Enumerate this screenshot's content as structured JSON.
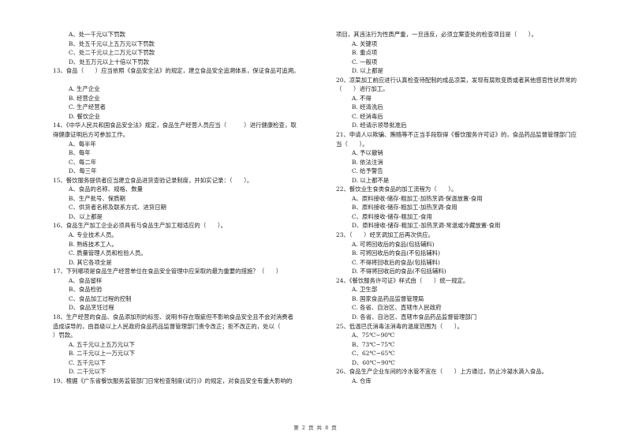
{
  "page": {
    "footer": "第 2 页 共 8 页"
  },
  "left_column": [
    {
      "type": "opt",
      "text": "A、处一千元以下罚款"
    },
    {
      "type": "opt",
      "text": "B、处五千元以上五万元以下罚款"
    },
    {
      "type": "opt",
      "text": "C、处二千元以上二万元以下罚款"
    },
    {
      "type": "opt",
      "text": "D、处五万元以上十倍以下罚款"
    },
    {
      "type": "q",
      "text": "13、食品（　　）应当依照《食品安全法》的规定，建立食品安全追溯体系，保证食品可追溯。"
    },
    {
      "type": "blank",
      "text": ""
    },
    {
      "type": "opt",
      "text": "A. 生产企业"
    },
    {
      "type": "opt",
      "text": "B. 经营企业"
    },
    {
      "type": "opt",
      "text": "C. 生产经营者"
    },
    {
      "type": "opt",
      "text": "D. 餐饮企业"
    },
    {
      "type": "q",
      "text": "14、《中华人民共和国食品安全法》规定，食品生产经营人员应当（　　　）进行健康检查，取"
    },
    {
      "type": "q",
      "text": "得健康证明后方可参加工作。"
    },
    {
      "type": "opt",
      "text": "A、每半年"
    },
    {
      "type": "opt",
      "text": "B、每年"
    },
    {
      "type": "opt",
      "text": "C、每二年"
    },
    {
      "type": "opt",
      "text": "D、每三年"
    },
    {
      "type": "q",
      "text": "15、餐饮服务提供者应当建立食品进货查验记录制度，并如实记录：（　　）。"
    },
    {
      "type": "opt",
      "text": "A、食品的名称、规格、数量"
    },
    {
      "type": "opt",
      "text": "B、生产批号、保质期"
    },
    {
      "type": "opt",
      "text": "C、供货者名称及联系方式、进货日期"
    },
    {
      "type": "opt",
      "text": "D、以上都是"
    },
    {
      "type": "q",
      "text": "16、食品生产加工企业必须具有与食品生产加工相适应的（　　）。"
    },
    {
      "type": "opt",
      "text": "A. 专业技术人员。"
    },
    {
      "type": "opt",
      "text": "B. 熟练技术工人。"
    },
    {
      "type": "opt",
      "text": "C. 质量管理人员和检验人员。"
    },
    {
      "type": "opt",
      "text": "D. 其它各项全是"
    },
    {
      "type": "q",
      "text": "17、下列哪项是食品生产经营单位在食品安全管理中应采取的最为重要的措施？（　　）"
    },
    {
      "type": "opt",
      "text": "A、食品留样"
    },
    {
      "type": "opt",
      "text": "B、食品检验"
    },
    {
      "type": "opt",
      "text": "C、食品加工过程的控制"
    },
    {
      "type": "opt",
      "text": "D、食品烹饪过程"
    },
    {
      "type": "q",
      "text": "18、生产经营的食品、食品添加剂的标签、说明书存在瑕疵但不影响食品安全且不会对消费者"
    },
    {
      "type": "q",
      "text": "造成误导的，由县级以上人民政府食品药品监督管理部门责令改正；拒不改正的，处以（"
    },
    {
      "type": "q",
      "text": "）罚款。"
    },
    {
      "type": "opt",
      "text": "A. 五千元以上五万元以下"
    },
    {
      "type": "opt",
      "text": "B. 二千元以上一万元以下"
    },
    {
      "type": "opt",
      "text": "C. 五千元以下"
    },
    {
      "type": "opt",
      "text": "D. 二千元以下"
    },
    {
      "type": "q",
      "text": "19、根据《广东省餐饮服务监管部门日常检查制度(试行)》的规定，对食品安全有重大影响的"
    }
  ],
  "right_column": [
    {
      "type": "q",
      "text": "项目，其违法行为性质严重，一旦违反，必须立案查处的检查项目是（　　）。"
    },
    {
      "type": "opt",
      "text": "A. 关键项"
    },
    {
      "type": "opt",
      "text": "B. 重点项"
    },
    {
      "type": "opt",
      "text": "C. 一般项"
    },
    {
      "type": "opt",
      "text": "D. 以上都是"
    },
    {
      "type": "q",
      "text": "20、凉菜加工前应进行认真检查待配制的成品凉菜，发现有腐败变质或者其他感官性状异常的"
    },
    {
      "type": "q",
      "text": "（　　）进行加工。"
    },
    {
      "type": "opt",
      "text": "A. 不得"
    },
    {
      "type": "opt",
      "text": "B. 经清洗后"
    },
    {
      "type": "opt",
      "text": "C. 经消毒后"
    },
    {
      "type": "opt",
      "text": "D. 经请示领导批准后"
    },
    {
      "type": "q",
      "text": "21、申请人以欺骗、贿赂等不正当手段取得《餐饮服务许可证》的，食品药品监督管理部门应"
    },
    {
      "type": "q",
      "text": "当（　　）。"
    },
    {
      "type": "opt",
      "text": "A. 予以撤销"
    },
    {
      "type": "opt",
      "text": "B. 依法注消"
    },
    {
      "type": "opt",
      "text": "C. 给予警告"
    },
    {
      "type": "opt",
      "text": "D. 以上都不是"
    },
    {
      "type": "q",
      "text": "22、餐饮业生食类食品的加工流程为（　　）。"
    },
    {
      "type": "opt",
      "text": "A、原料接收-储存-粗加工-加热烹调-保温放置-食用"
    },
    {
      "type": "opt",
      "text": "B、原料接收-储存-粗加工-加热烹调-食用"
    },
    {
      "type": "opt",
      "text": "C、原料接收-储存-粗加工-食用"
    },
    {
      "type": "opt",
      "text": "D、原料接收-储存-粗加工-加热烹调-常温或冷藏放置-食用"
    },
    {
      "type": "q",
      "text": "23、（　　）经烹调加工后再次供应。"
    },
    {
      "type": "opt",
      "text": "A. 可将回收后的食品(包括辅料)"
    },
    {
      "type": "opt",
      "text": "B. 可将回收后的食品(不包括辅料)"
    },
    {
      "type": "opt",
      "text": "C. 不得将回收后的食品(包括辅料)"
    },
    {
      "type": "opt",
      "text": "D. 不得将回收后的食品(不包括辅料)"
    },
    {
      "type": "q",
      "text": "24、《餐饮服务许可证》样式由（　　）统一规定。"
    },
    {
      "type": "opt",
      "text": "A. 卫生部"
    },
    {
      "type": "opt",
      "text": "B. 国家食品药品监督管理局"
    },
    {
      "type": "opt",
      "text": "C. 各省、自治区、直辖市人民政府"
    },
    {
      "type": "opt",
      "text": "D. 各省、自治区、直辖市食品药品监督管理部门"
    },
    {
      "type": "q",
      "text": "25、低温巴氏消毒法消毒的温度范围为（　　）。"
    },
    {
      "type": "opt",
      "text": "A、75℃~90℃"
    },
    {
      "type": "opt",
      "text": "B、73℃~75℃"
    },
    {
      "type": "opt",
      "text": "C、62℃~65℃"
    },
    {
      "type": "opt",
      "text": "D、60℃~90℃"
    },
    {
      "type": "q",
      "text": "26、食品生产企业车间的冷水管不宜在（　　）上方通过，防止冷凝水滴入食品。"
    },
    {
      "type": "opt",
      "text": "A. 仓库"
    }
  ]
}
